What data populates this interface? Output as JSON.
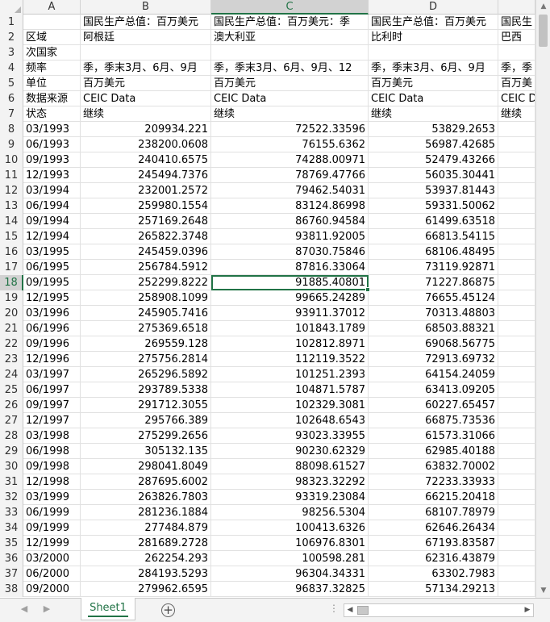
{
  "sheet": {
    "active_cell_row": 18,
    "active_col": "C",
    "columns": [
      "A",
      "B",
      "C",
      "D",
      ""
    ],
    "tab_label": "Sheet1",
    "add_sheet_icon": "+",
    "nav_prev_icon": "◀",
    "nav_next_icon": "▶",
    "more_tabs_icon": "⋮"
  },
  "header_rows": [
    {
      "row": 1,
      "cells": [
        "",
        "国民生产总值：百万美元",
        "国民生产总值：百万美元：季",
        "国民生产总值：百万美元",
        "国民生"
      ]
    },
    {
      "row": 2,
      "cells": [
        "区域",
        "阿根廷",
        "澳大利亚",
        "比利时",
        "巴西"
      ]
    },
    {
      "row": 3,
      "cells": [
        "次国家",
        "",
        "",
        "",
        ""
      ]
    },
    {
      "row": 4,
      "cells": [
        "频率",
        "季，季末3月、6月、9月",
        "季，季末3月、6月、9月、12",
        "季，季末3月、6月、9月",
        "季，季"
      ]
    },
    {
      "row": 5,
      "cells": [
        "单位",
        "百万美元",
        "百万美元",
        "百万美元",
        "百万美"
      ]
    },
    {
      "row": 6,
      "cells": [
        "数据来源",
        "CEIC Data",
        "CEIC Data",
        "CEIC Data",
        "CEIC D"
      ]
    },
    {
      "row": 7,
      "cells": [
        "状态",
        "继续",
        "继续",
        "继续",
        "继续"
      ]
    }
  ],
  "data_rows": [
    {
      "row": 8,
      "date": "03/1993",
      "b": "209934.221",
      "c": "72522.33596",
      "d": "53829.2653"
    },
    {
      "row": 9,
      "date": "06/1993",
      "b": "238200.0608",
      "c": "76155.6362",
      "d": "56987.42685"
    },
    {
      "row": 10,
      "date": "09/1993",
      "b": "240410.6575",
      "c": "74288.00971",
      "d": "52479.43266"
    },
    {
      "row": 11,
      "date": "12/1993",
      "b": "245494.7376",
      "c": "78769.47766",
      "d": "56035.30441"
    },
    {
      "row": 12,
      "date": "03/1994",
      "b": "232001.2572",
      "c": "79462.54031",
      "d": "53937.81443"
    },
    {
      "row": 13,
      "date": "06/1994",
      "b": "259980.1554",
      "c": "83124.86998",
      "d": "59331.50062"
    },
    {
      "row": 14,
      "date": "09/1994",
      "b": "257169.2648",
      "c": "86760.94584",
      "d": "61499.63518"
    },
    {
      "row": 15,
      "date": "12/1994",
      "b": "265822.3748",
      "c": "93811.92005",
      "d": "66813.54115"
    },
    {
      "row": 16,
      "date": "03/1995",
      "b": "245459.0396",
      "c": "87030.75846",
      "d": "68106.48495"
    },
    {
      "row": 17,
      "date": "06/1995",
      "b": "256784.5912",
      "c": "87816.33064",
      "d": "73119.92871"
    },
    {
      "row": 18,
      "date": "09/1995",
      "b": "252299.8222",
      "c": "91885.40801",
      "d": "71227.86875"
    },
    {
      "row": 19,
      "date": "12/1995",
      "b": "258908.1099",
      "c": "99665.24289",
      "d": "76655.45124"
    },
    {
      "row": 20,
      "date": "03/1996",
      "b": "245905.7416",
      "c": "93911.37012",
      "d": "70313.48803"
    },
    {
      "row": 21,
      "date": "06/1996",
      "b": "275369.6518",
      "c": "101843.1789",
      "d": "68503.88321"
    },
    {
      "row": 22,
      "date": "09/1996",
      "b": "269559.128",
      "c": "102812.8971",
      "d": "69068.56775"
    },
    {
      "row": 23,
      "date": "12/1996",
      "b": "275756.2814",
      "c": "112119.3522",
      "d": "72913.69732"
    },
    {
      "row": 24,
      "date": "03/1997",
      "b": "265296.5892",
      "c": "101251.2393",
      "d": "64154.24059"
    },
    {
      "row": 25,
      "date": "06/1997",
      "b": "293789.5338",
      "c": "104871.5787",
      "d": "63413.09205"
    },
    {
      "row": 26,
      "date": "09/1997",
      "b": "291712.3055",
      "c": "102329.3081",
      "d": "60227.65457"
    },
    {
      "row": 27,
      "date": "12/1997",
      "b": "295766.389",
      "c": "102648.6543",
      "d": "66875.73536"
    },
    {
      "row": 28,
      "date": "03/1998",
      "b": "275299.2656",
      "c": "93023.33955",
      "d": "61573.31066"
    },
    {
      "row": 29,
      "date": "06/1998",
      "b": "305132.135",
      "c": "90230.62329",
      "d": "62985.40188"
    },
    {
      "row": 30,
      "date": "09/1998",
      "b": "298041.8049",
      "c": "88098.61527",
      "d": "63832.70002"
    },
    {
      "row": 31,
      "date": "12/1998",
      "b": "287695.6002",
      "c": "98323.32292",
      "d": "72233.33933"
    },
    {
      "row": 32,
      "date": "03/1999",
      "b": "263826.7803",
      "c": "93319.23084",
      "d": "66215.20418"
    },
    {
      "row": 33,
      "date": "06/1999",
      "b": "281236.1884",
      "c": "98256.5304",
      "d": "68107.78979"
    },
    {
      "row": 34,
      "date": "09/1999",
      "b": "277484.879",
      "c": "100413.6326",
      "d": "62646.26434"
    },
    {
      "row": 35,
      "date": "12/1999",
      "b": "281689.2728",
      "c": "106976.8301",
      "d": "67193.83587"
    },
    {
      "row": 36,
      "date": "03/2000",
      "b": "262254.293",
      "c": "100598.281",
      "d": "62316.43879"
    },
    {
      "row": 37,
      "date": "06/2000",
      "b": "284193.5293",
      "c": "96304.34331",
      "d": "63302.7983"
    },
    {
      "row": 38,
      "date": "09/2000",
      "b": "279962.6595",
      "c": "96837.32825",
      "d": "57134.29213"
    }
  ],
  "colors": {
    "accent": "#217346",
    "grid": "#e1e1e1",
    "header_bg": "#f3f3f3"
  }
}
